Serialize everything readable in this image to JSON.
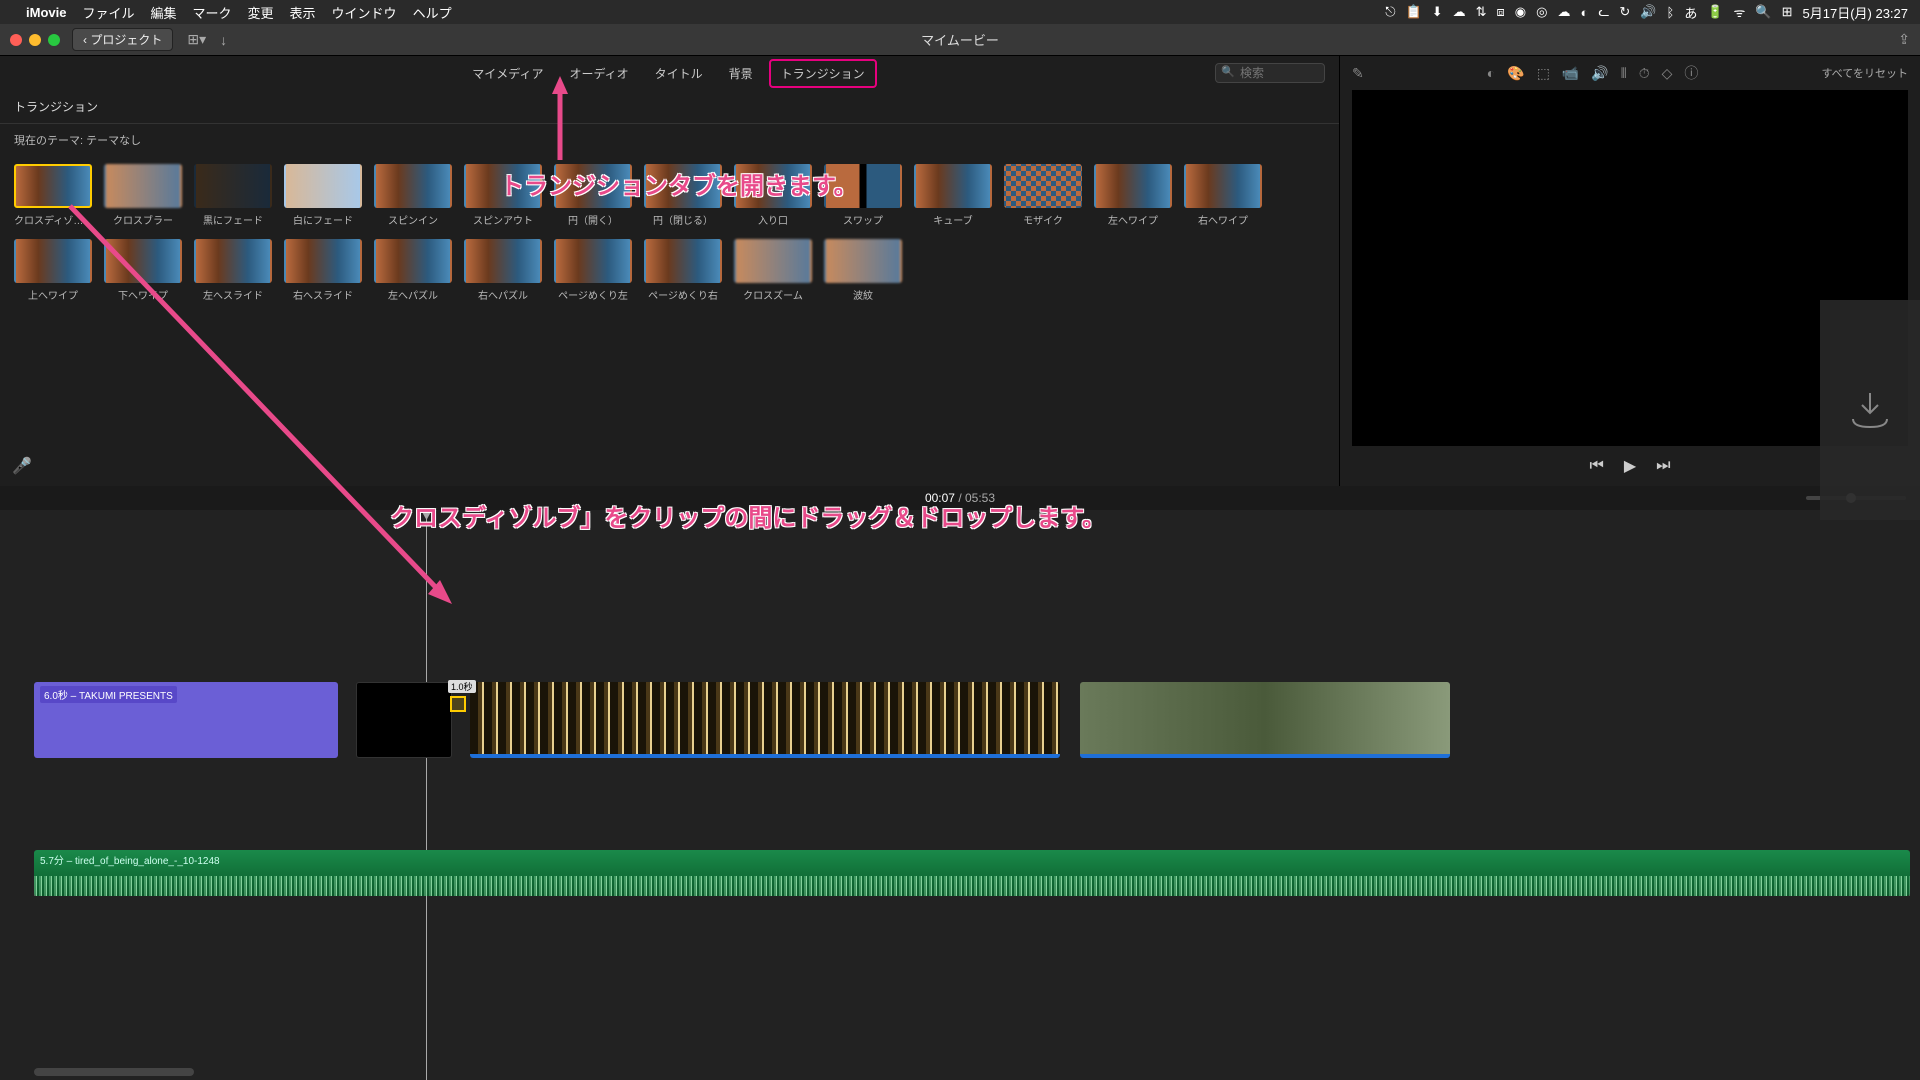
{
  "menubar": {
    "app": "iMovie",
    "items": [
      "ファイル",
      "編集",
      "マーク",
      "変更",
      "表示",
      "ウインドウ",
      "ヘルプ"
    ],
    "date": "5月17日(月) 23:27"
  },
  "toolbar": {
    "back_label": "プロジェクト",
    "window_title": "マイムービー"
  },
  "browser": {
    "tabs": [
      "マイメディア",
      "オーディオ",
      "タイトル",
      "背景",
      "トランジション"
    ],
    "active_tab": 4,
    "search_placeholder": "検索",
    "panel_title": "トランジション",
    "theme_label": "現在のテーマ: テーマなし",
    "transitions": [
      {
        "label": "クロスディゾルブ",
        "cls": "",
        "selected": true
      },
      {
        "label": "クロスブラー",
        "cls": "blur"
      },
      {
        "label": "黒にフェード",
        "cls": "dark"
      },
      {
        "label": "白にフェード",
        "cls": "light"
      },
      {
        "label": "スピンイン",
        "cls": ""
      },
      {
        "label": "スピンアウト",
        "cls": ""
      },
      {
        "label": "円（開く）",
        "cls": ""
      },
      {
        "label": "円（閉じる）",
        "cls": ""
      },
      {
        "label": "入り口",
        "cls": ""
      },
      {
        "label": "スワップ",
        "cls": "swap"
      },
      {
        "label": "キューブ",
        "cls": ""
      },
      {
        "label": "モザイク",
        "cls": "mosaic"
      },
      {
        "label": "左へワイプ",
        "cls": ""
      },
      {
        "label": "右へワイプ",
        "cls": ""
      },
      {
        "label": "上へワイプ",
        "cls": ""
      },
      {
        "label": "下へワイプ",
        "cls": ""
      },
      {
        "label": "左へスライド",
        "cls": ""
      },
      {
        "label": "右へスライド",
        "cls": ""
      },
      {
        "label": "左へパズル",
        "cls": ""
      },
      {
        "label": "右へパズル",
        "cls": ""
      },
      {
        "label": "ページめくり左",
        "cls": ""
      },
      {
        "label": "ページめくり右",
        "cls": ""
      },
      {
        "label": "クロスズーム",
        "cls": "blur"
      },
      {
        "label": "波紋",
        "cls": "blur"
      }
    ]
  },
  "viewer": {
    "reset_label": "すべてをリセット"
  },
  "time": {
    "current": "00:07",
    "total": "05:53"
  },
  "timeline": {
    "title_clip": "6.0秒 – TAKUMI PRESENTS",
    "drop_tip": "1.0秒",
    "audio_label": "5.7分 – tired_of_being_alone_-_10-1248"
  },
  "annotations": {
    "top": "トランジションタブを開きます。",
    "bottom": "クロスディゾルブ」をクリップの間にドラッグ＆ドロップします。"
  }
}
